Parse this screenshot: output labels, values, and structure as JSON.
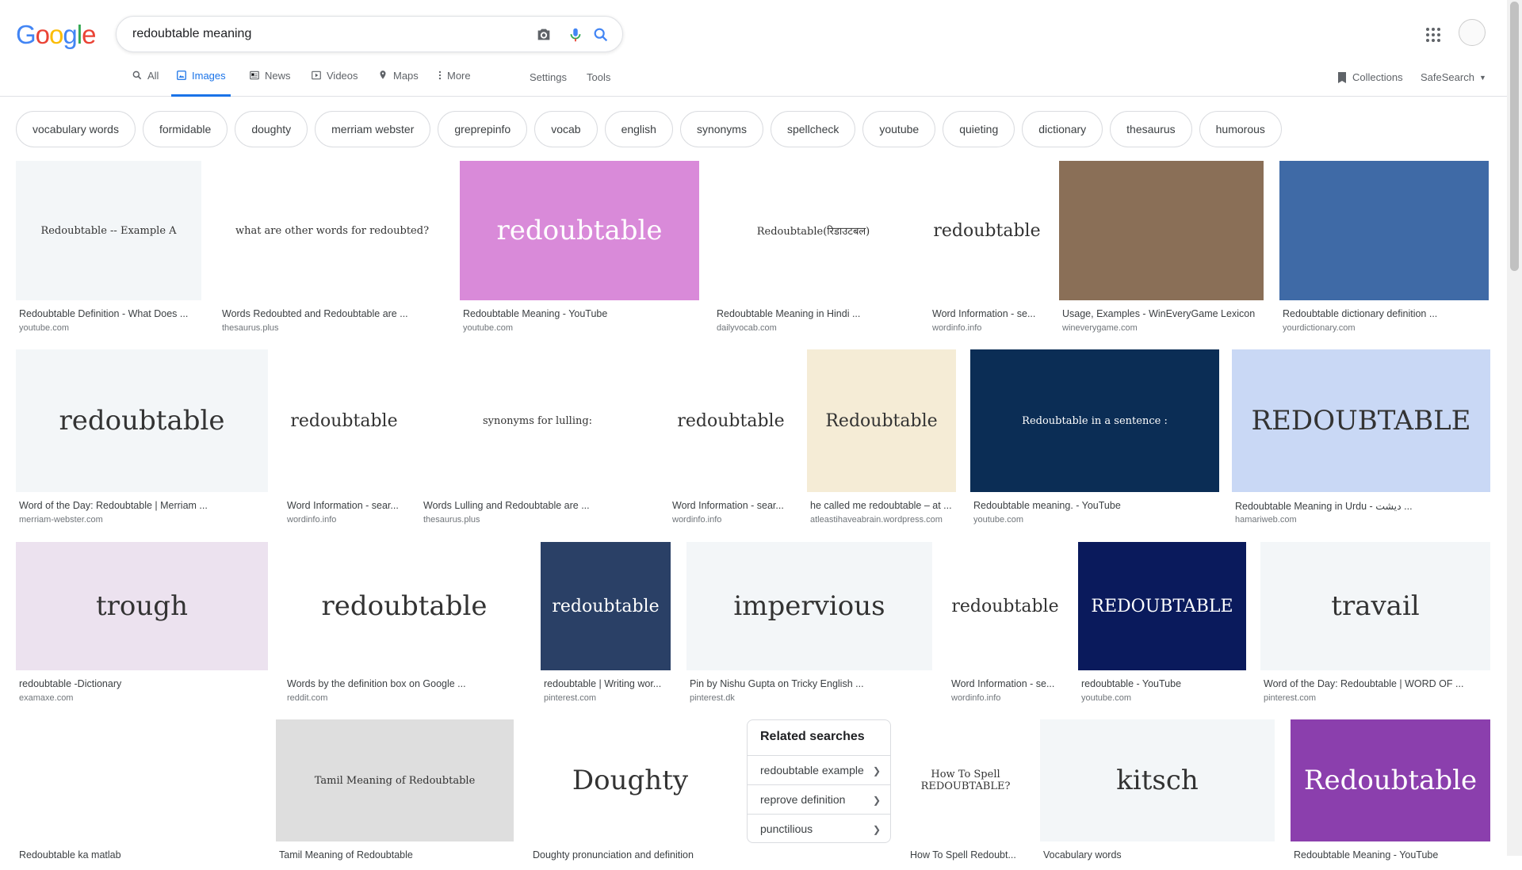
{
  "header": {
    "logo": [
      "G",
      "o",
      "o",
      "g",
      "l",
      "e"
    ],
    "logo_colors": [
      "#4285f4",
      "#ea4335",
      "#fbbc05",
      "#4285f4",
      "#34a853",
      "#ea4335"
    ],
    "search_value": "redoubtable meaning"
  },
  "tabs": [
    {
      "label": "All",
      "icon": "search-icon"
    },
    {
      "label": "Images",
      "icon": "image-icon"
    },
    {
      "label": "News",
      "icon": "news-icon"
    },
    {
      "label": "Videos",
      "icon": "video-icon"
    },
    {
      "label": "Maps",
      "icon": "map-icon"
    },
    {
      "label": "More",
      "icon": "more-vert-icon"
    }
  ],
  "tools": {
    "settings": "Settings",
    "tools": "Tools",
    "collections": "Collections",
    "safesearch": "SafeSearch"
  },
  "chips": [
    "vocabulary words",
    "formidable",
    "doughty",
    "merriam webster",
    "greprepinfo",
    "vocab",
    "english",
    "synonyms",
    "spellcheck",
    "youtube",
    "quieting",
    "dictionary",
    "thesaurus",
    "humorous"
  ],
  "results": [
    {
      "title": "Redoubtable Definition - What Does ...",
      "source": "youtube.com",
      "thumb_text": "Redoubtable -- Example A",
      "bg": "#f3f6f8"
    },
    {
      "title": "Words Redoubted and Redoubtable are ...",
      "source": "thesaurus.plus",
      "thumb_text": "what are other words for redoubted?",
      "bg": "#ffffff"
    },
    {
      "title": "Redoubtable Meaning - YouTube",
      "source": "youtube.com",
      "thumb_text": "redoubtable",
      "bg": "#d98ad9"
    },
    {
      "title": "Redoubtable Meaning in Hindi ...",
      "source": "dailyvocab.com",
      "thumb_text": "Redoubtable(रिडाउटबल)",
      "bg": "#ffffff"
    },
    {
      "title": "Word Information - se...",
      "source": "wordinfo.info",
      "thumb_text": "redoubtable",
      "bg": "#ffffff"
    },
    {
      "title": "Usage, Examples - WinEveryGame Lexicon",
      "source": "wineverygame.com",
      "thumb_text": "",
      "bg": "#8a6f57"
    },
    {
      "title": "Redoubtable dictionary definition ...",
      "source": "yourdictionary.com",
      "thumb_text": "",
      "bg": "#3f6aa6"
    },
    {
      "title": "Word of the Day: Redoubtable | Merriam ...",
      "source": "merriam-webster.com",
      "thumb_text": "redoubtable",
      "bg": "#f3f6f8"
    },
    {
      "title": "Word Information - sear...",
      "source": "wordinfo.info",
      "thumb_text": "redoubtable",
      "bg": "#ffffff"
    },
    {
      "title": "Words Lulling and Redoubtable are ...",
      "source": "thesaurus.plus",
      "thumb_text": "synonyms for lulling:",
      "bg": "#ffffff"
    },
    {
      "title": "Word Information - sear...",
      "source": "wordinfo.info",
      "thumb_text": "redoubtable",
      "bg": "#ffffff"
    },
    {
      "title": "he called me redoubtable – at ...",
      "source": "atleastihaveabrain.wordpress.com",
      "thumb_text": "Redoubtable",
      "bg": "#f5ecd6"
    },
    {
      "title": "Redoubtable meaning. - YouTube",
      "source": "youtube.com",
      "thumb_text": "Redoubtable in a sentence :",
      "bg": "#0b2d55"
    },
    {
      "title": "Redoubtable Meaning in Urdu - دیشت ...",
      "source": "hamariweb.com",
      "thumb_text": "REDOUBTABLE",
      "bg": "#c9d8f5"
    },
    {
      "title": "redoubtable -Dictionary",
      "source": "examaxe.com",
      "thumb_text": "trough",
      "bg": "#ece2ef"
    },
    {
      "title": "Words by the definition box on Google ...",
      "source": "reddit.com",
      "thumb_text": "redoubtable",
      "bg": "#ffffff"
    },
    {
      "title": "redoubtable | Writing wor...",
      "source": "pinterest.com",
      "thumb_text": "redoubtable",
      "bg": "#2a4066"
    },
    {
      "title": "Pin by Nishu Gupta on Tricky English ...",
      "source": "pinterest.dk",
      "thumb_text": "impervious",
      "bg": "#f3f6f8"
    },
    {
      "title": "Word Information - se...",
      "source": "wordinfo.info",
      "thumb_text": "redoubtable",
      "bg": "#ffffff"
    },
    {
      "title": "redoubtable - YouTube",
      "source": "youtube.com",
      "thumb_text": "REDOUBTABLE",
      "bg": "#0a1a5c"
    },
    {
      "title": "Word of the Day: Redoubtable | WORD OF ...",
      "source": "pinterest.com",
      "thumb_text": "travail",
      "bg": "#f3f6f8"
    },
    {
      "title": "Redoubtable ka matlab",
      "source": "",
      "thumb_text": "",
      "bg": "#ffffff"
    },
    {
      "title": "Tamil Meaning of Redoubtable",
      "source": "",
      "thumb_text": "Tamil Meaning of Redoubtable",
      "bg": "#dedede"
    },
    {
      "title": "Doughty pronunciation and definition",
      "source": "",
      "thumb_text": "Doughty",
      "bg": "#ffffff"
    },
    {
      "title": "How To Spell Redoubt...",
      "source": "",
      "thumb_text": "How To Spell REDOUBTABLE?",
      "bg": "#ffffff"
    },
    {
      "title": "Vocabulary words",
      "source": "",
      "thumb_text": "kitsch",
      "bg": "#f3f6f8"
    },
    {
      "title": "Redoubtable Meaning - YouTube",
      "source": "",
      "thumb_text": "Redoubtable",
      "bg": "#8b3fad"
    }
  ],
  "related": {
    "heading": "Related searches",
    "items": [
      "redoubtable example",
      "reprove definition",
      "punctilious"
    ]
  }
}
